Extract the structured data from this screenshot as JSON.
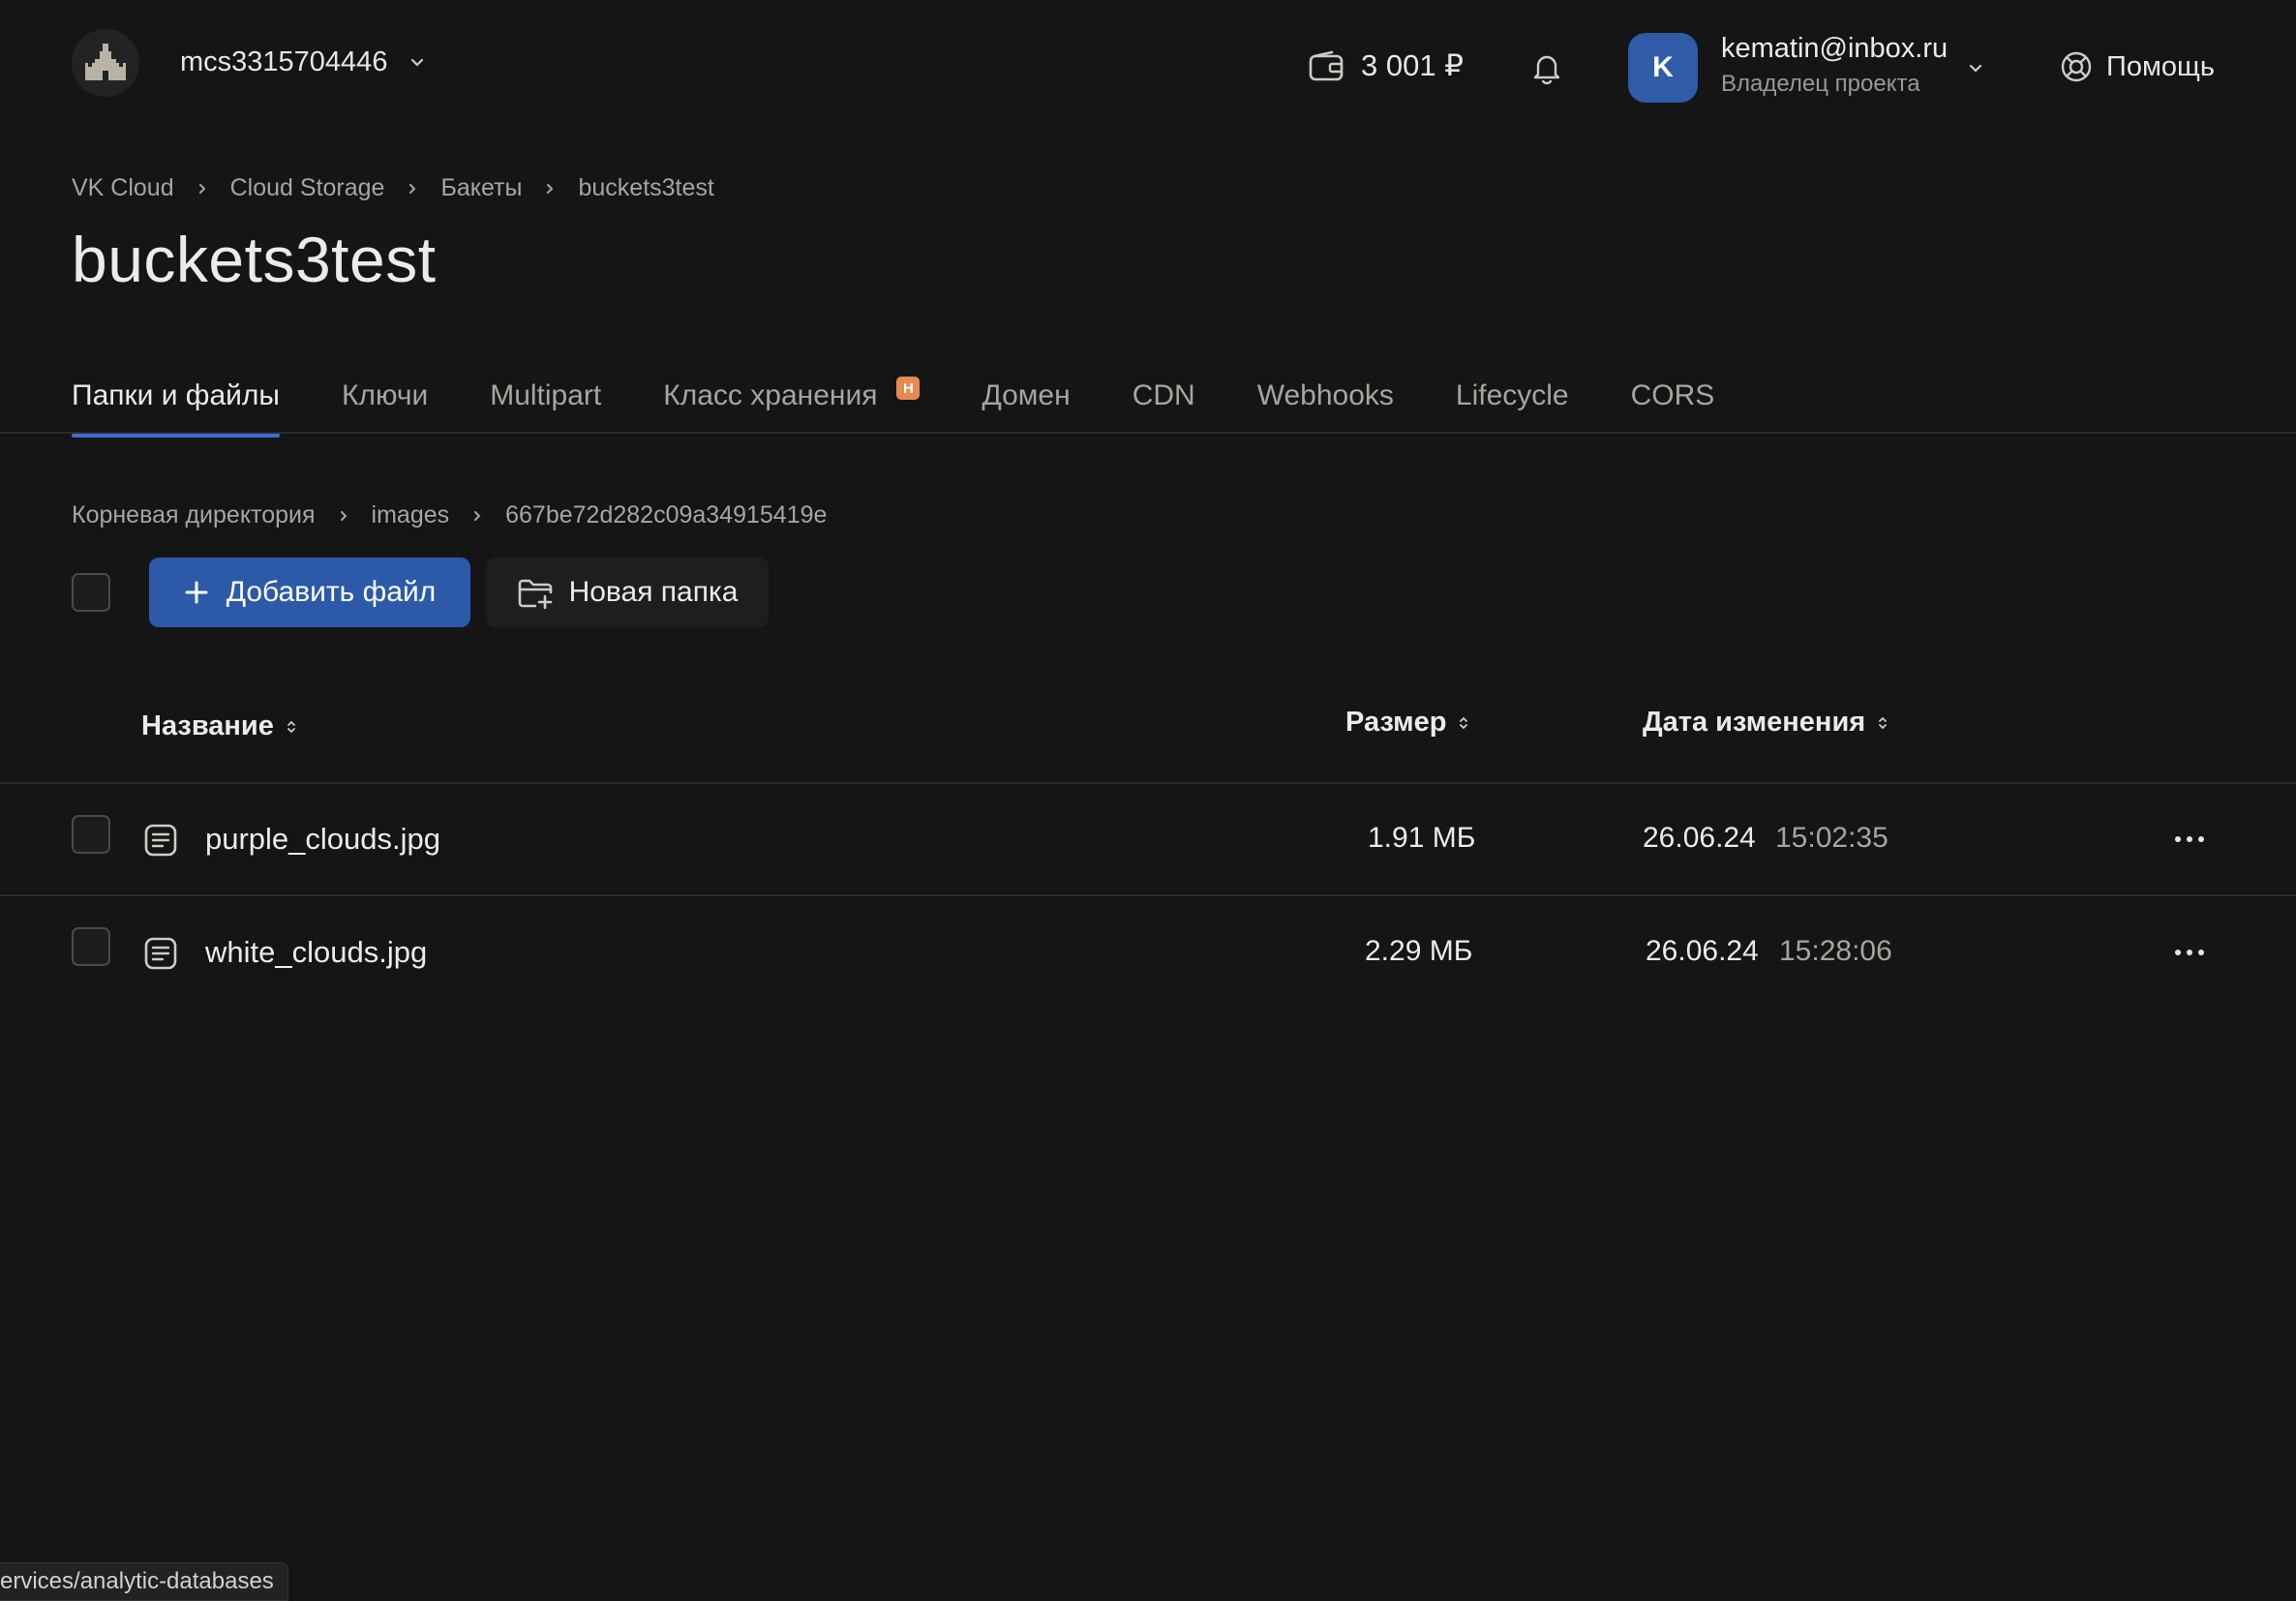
{
  "header": {
    "project_name": "mcs3315704446",
    "balance": "3 001 ₽",
    "avatar_letter": "K",
    "user_email": "kematin@inbox.ru",
    "user_role": "Владелец проекта",
    "help_label": "Помощь"
  },
  "breadcrumb": [
    "VK Cloud",
    "Cloud Storage",
    "Бакеты",
    "buckets3test"
  ],
  "page_title": "buckets3test",
  "tabs": [
    {
      "label": "Папки и файлы",
      "active": true
    },
    {
      "label": "Ключи"
    },
    {
      "label": "Multipart"
    },
    {
      "label": "Класс хранения",
      "badge": "Н"
    },
    {
      "label": "Домен"
    },
    {
      "label": "CDN"
    },
    {
      "label": "Webhooks"
    },
    {
      "label": "Lifecycle"
    },
    {
      "label": "CORS"
    }
  ],
  "directory_path": [
    "Корневая директория",
    "images",
    "667be72d282c09a34915419e"
  ],
  "toolbar": {
    "add_file_label": "Добавить файл",
    "new_folder_label": "Новая папка"
  },
  "table": {
    "columns": {
      "name": "Название",
      "size": "Размер",
      "modified": "Дата изменения"
    },
    "rows": [
      {
        "name": "purple_clouds.jpg",
        "size": "1.91 МБ",
        "date": "26.06.24",
        "time": "15:02:35"
      },
      {
        "name": "white_clouds.jpg",
        "size": "2.29 МБ",
        "date": "26.06.24",
        "time": "15:28:06"
      }
    ]
  },
  "status_url": "ervices/analytic-databases",
  "colors": {
    "accent": "#2c5aa8",
    "badge": "#e8894f",
    "background": "#151515"
  }
}
